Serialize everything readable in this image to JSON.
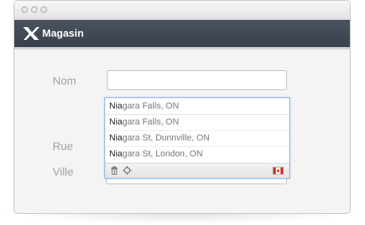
{
  "app": {
    "brand": "Magasin",
    "logo_icon": "x-logo-icon"
  },
  "form": {
    "nom_label": "Nom",
    "rue_label": "Rue",
    "ville_label": "Ville",
    "nom_value": "",
    "rue_value": "",
    "ville_value": ""
  },
  "autocomplete": {
    "query_match": "Nia",
    "query_rest": "gara Falls, ON",
    "suggestions": [
      {
        "match": "Nia",
        "rest": "gara Falls, ON"
      },
      {
        "match": "Nia",
        "rest": "gara St, Dunnville, ON"
      },
      {
        "match": "Nia",
        "rest": "gara St, London, ON"
      }
    ],
    "footer_icons": [
      "trash-icon",
      "locate-icon"
    ],
    "country_flag": "canada-flag-icon"
  },
  "colors": {
    "header": "#3e4652",
    "focus_border": "#8fb8e6",
    "label": "#a0a0a0",
    "flag_red": "#d52b1e"
  }
}
